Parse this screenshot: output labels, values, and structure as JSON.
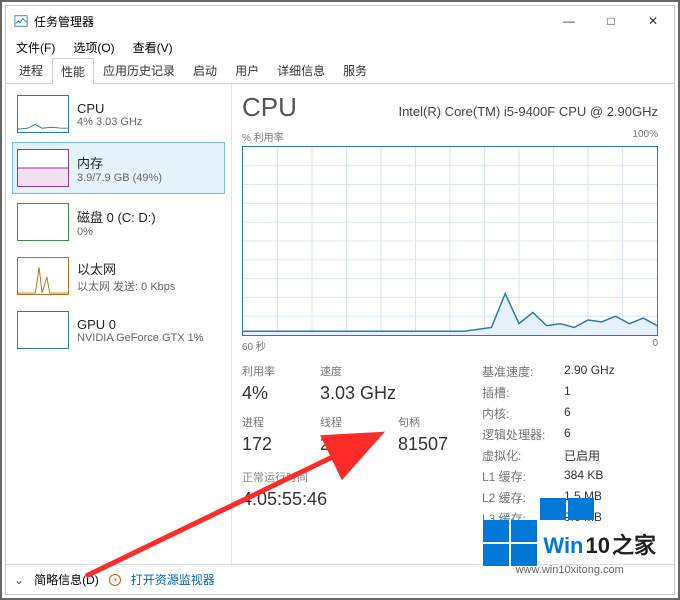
{
  "window": {
    "title": "任务管理器",
    "controls": {
      "min": "—",
      "max": "□",
      "close": "✕"
    }
  },
  "menu": {
    "file": "文件(F)",
    "options": "选项(O)",
    "view": "查看(V)"
  },
  "tabs": [
    "进程",
    "性能",
    "应用历史记录",
    "启动",
    "用户",
    "详细信息",
    "服务"
  ],
  "active_tab_index": 1,
  "sidebar": [
    {
      "title": "CPU",
      "sub": "4% 3.03 GHz",
      "kind": "cpu"
    },
    {
      "title": "内存",
      "sub": "3.9/7.9 GB (49%)",
      "kind": "mem",
      "selected": true
    },
    {
      "title": "磁盘 0 (C: D:)",
      "sub": "0%",
      "kind": "disk"
    },
    {
      "title": "以太网",
      "sub": "以太网 发送: 0 Kbps",
      "kind": "eth"
    },
    {
      "title": "GPU 0",
      "sub": "NVIDIA GeForce GTX   1%",
      "kind": "gpu"
    }
  ],
  "cpu": {
    "title": "CPU",
    "model": "Intel(R) Core(TM) i5-9400F CPU @ 2.90GHz",
    "y_label": "% 利用率",
    "y_max": "100%",
    "x_left": "60 秒",
    "x_right": "0"
  },
  "stats_left": {
    "row1_labels": [
      "利用率",
      "速度"
    ],
    "row1_values": [
      "4%",
      "3.03 GHz"
    ],
    "row2_labels": [
      "进程",
      "线程",
      "句柄"
    ],
    "row2_values": [
      "172",
      "2226",
      "81507"
    ],
    "uptime_label": "正常运行时间",
    "uptime_value": "4:05:55:46"
  },
  "stats_right": [
    {
      "k": "基准速度:",
      "v": "2.90 GHz"
    },
    {
      "k": "插槽:",
      "v": "1"
    },
    {
      "k": "内核:",
      "v": "6"
    },
    {
      "k": "逻辑处理器:",
      "v": "6"
    },
    {
      "k": "虚拟化:",
      "v": "已启用"
    },
    {
      "k": "L1 缓存:",
      "v": "384 KB"
    },
    {
      "k": "L2 缓存:",
      "v": "1.5 MB"
    },
    {
      "k": "L3 缓存:",
      "v": "9.0 MB"
    }
  ],
  "footer": {
    "brief": "简略信息(D)",
    "resource": "打开资源监视器"
  },
  "watermark": {
    "brand1": "Win",
    "brand2": "10",
    "brand3": "之家",
    "url": "www.win10xitong.com"
  },
  "chart_data": {
    "type": "line",
    "title": "% 利用率",
    "xlabel": "60 秒 → 0",
    "ylabel": "% 利用率",
    "ylim": [
      0,
      100
    ],
    "x_seconds": [
      60,
      58,
      56,
      54,
      52,
      50,
      48,
      46,
      44,
      42,
      40,
      38,
      36,
      34,
      32,
      30,
      28,
      26,
      24,
      22,
      20,
      18,
      16,
      14,
      12,
      10,
      8,
      6,
      4,
      2,
      0
    ],
    "values": [
      2,
      2,
      2,
      2,
      2,
      2,
      2,
      2,
      2,
      2,
      2,
      2,
      2,
      2,
      2,
      2,
      2,
      3,
      4,
      22,
      6,
      12,
      5,
      6,
      4,
      8,
      7,
      10,
      6,
      9,
      5
    ]
  }
}
